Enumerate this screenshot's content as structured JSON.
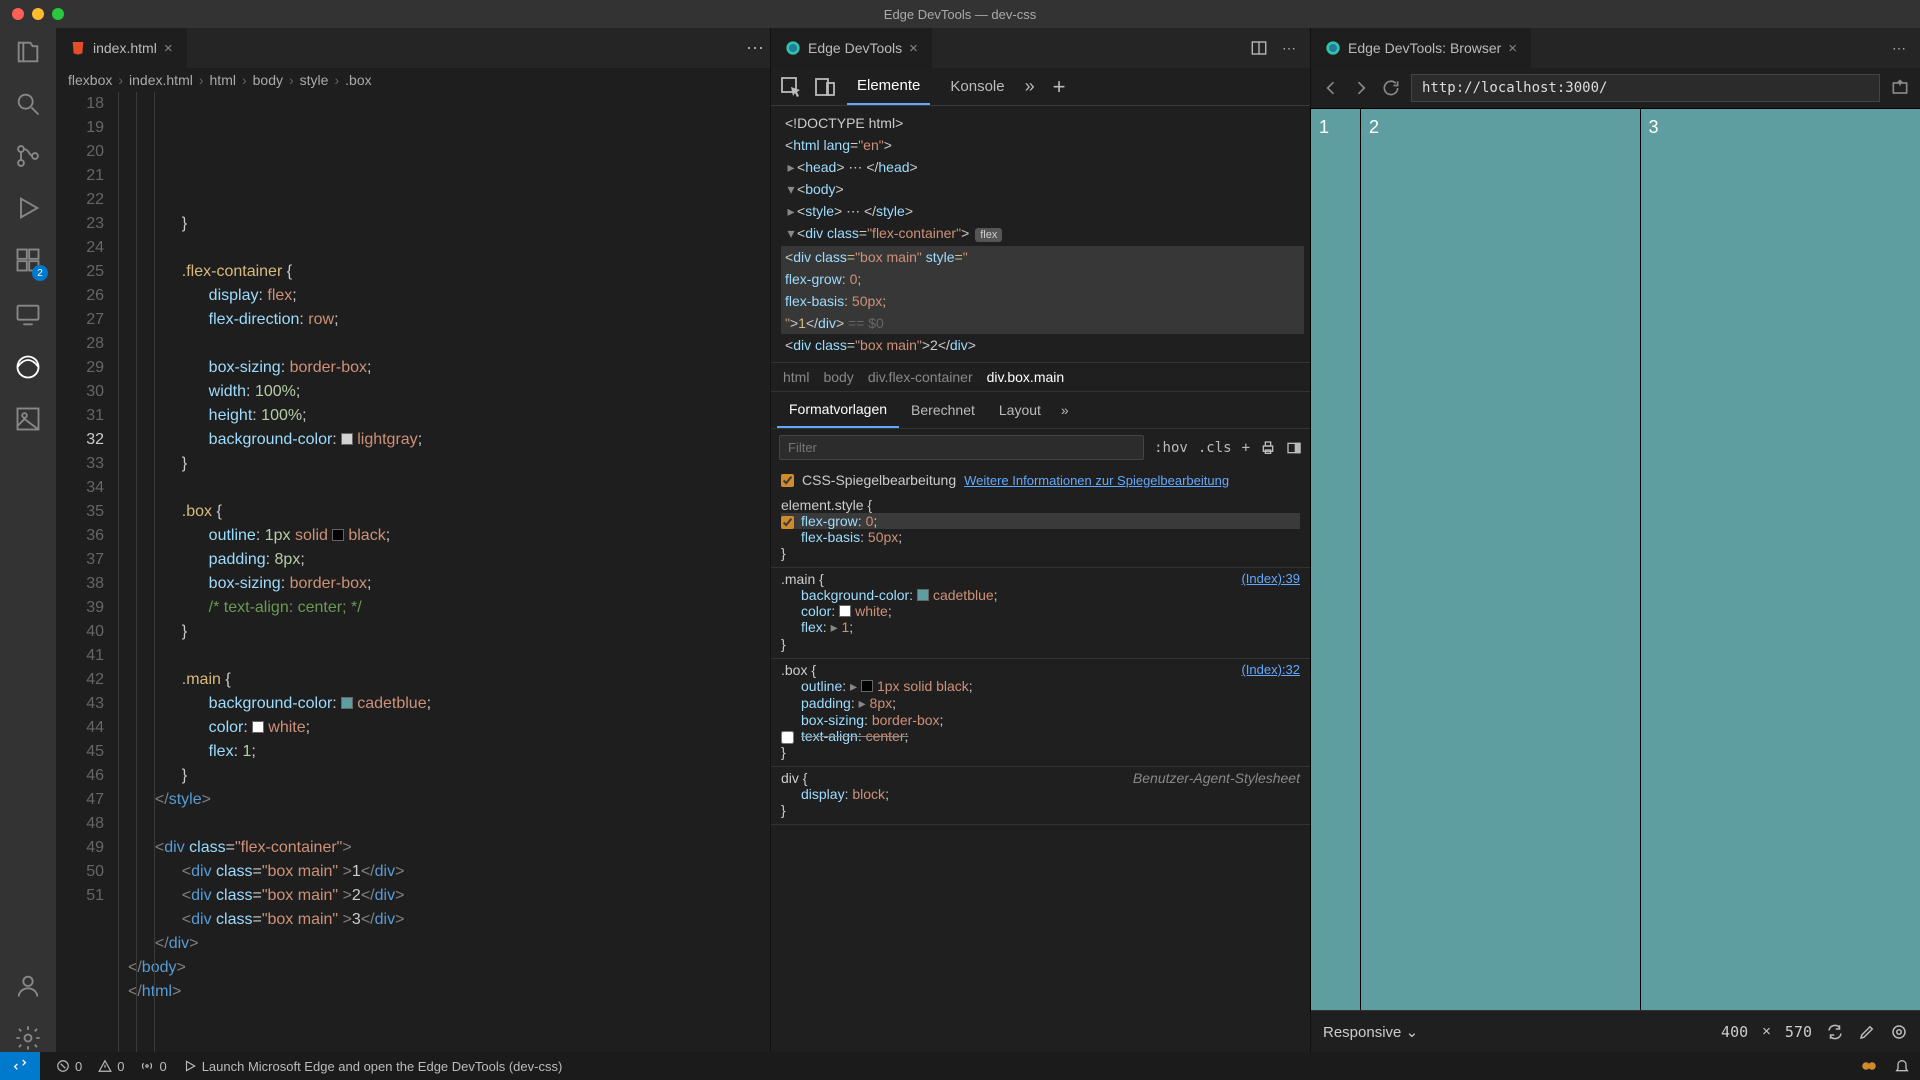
{
  "window": {
    "title": "Edge DevTools — dev-css"
  },
  "activity": {
    "badge": "2"
  },
  "editorTabs": {
    "main": {
      "label": "index.html"
    },
    "devtools": {
      "label": "Edge DevTools"
    },
    "browser": {
      "label": "Edge DevTools: Browser"
    }
  },
  "breadcrumbs": [
    "flexbox",
    "index.html",
    "html",
    "body",
    "style",
    ".box"
  ],
  "codeStartLine": 18,
  "code": [
    {
      "i": 2,
      "html": "<span class='punc'>}</span>"
    },
    {
      "i": 0,
      "html": ""
    },
    {
      "i": 2,
      "html": "<span class='sel'>.flex-container</span> <span class='punc'>{</span>"
    },
    {
      "i": 3,
      "html": "<span class='prop'>display</span><span class='punc'>:</span> <span class='val'>flex</span><span class='punc'>;</span>"
    },
    {
      "i": 3,
      "html": "<span class='prop'>flex-direction</span><span class='punc'>:</span> <span class='val'>row</span><span class='punc'>;</span>"
    },
    {
      "i": 0,
      "html": ""
    },
    {
      "i": 3,
      "html": "<span class='prop'>box-sizing</span><span class='punc'>:</span> <span class='val'>border-box</span><span class='punc'>;</span>"
    },
    {
      "i": 3,
      "html": "<span class='prop'>width</span><span class='punc'>:</span> <span class='num'>100%</span><span class='punc'>;</span>"
    },
    {
      "i": 3,
      "html": "<span class='prop'>height</span><span class='punc'>:</span> <span class='num'>100%</span><span class='punc'>;</span>"
    },
    {
      "i": 3,
      "html": "<span class='prop'>background-color</span><span class='punc'>:</span> <span class='swatch lg'></span><span class='val'>lightgray</span><span class='punc'>;</span>"
    },
    {
      "i": 2,
      "html": "<span class='punc'>}</span>"
    },
    {
      "i": 0,
      "html": ""
    },
    {
      "i": 2,
      "html": "<span class='sel'>.box</span> <span class='punc'>{</span>"
    },
    {
      "i": 3,
      "html": "<span class='prop'>outline</span><span class='punc'>:</span> <span class='num'>1px</span> <span class='val'>solid</span> <span class='swatch bk'></span><span class='val'>black</span><span class='punc'>;</span>"
    },
    {
      "i": 3,
      "html": "<span class='prop'>padding</span><span class='punc'>:</span> <span class='num'>8px</span><span class='punc'>;</span>",
      "current": true
    },
    {
      "i": 3,
      "html": "<span class='prop'>box-sizing</span><span class='punc'>:</span> <span class='val'>border-box</span><span class='punc'>;</span>"
    },
    {
      "i": 3,
      "html": "<span class='comm'>/* text-align: center; */</span>"
    },
    {
      "i": 2,
      "html": "<span class='punc'>}</span>"
    },
    {
      "i": 0,
      "html": ""
    },
    {
      "i": 2,
      "html": "<span class='sel'>.main</span> <span class='punc'>{</span>"
    },
    {
      "i": 3,
      "html": "<span class='prop'>background-color</span><span class='punc'>:</span> <span class='swatch cb'></span><span class='val'>cadetblue</span><span class='punc'>;</span>"
    },
    {
      "i": 3,
      "html": "<span class='prop'>color</span><span class='punc'>:</span> <span class='swatch wh'></span><span class='val'>white</span><span class='punc'>;</span>"
    },
    {
      "i": 3,
      "html": "<span class='prop'>flex</span><span class='punc'>:</span> <span class='num'>1</span><span class='punc'>;</span>"
    },
    {
      "i": 2,
      "html": "<span class='punc'>}</span>"
    },
    {
      "i": 1,
      "html": "<span class='tagbr'>&lt;/</span><span class='tag'>style</span><span class='tagbr'>&gt;</span>"
    },
    {
      "i": 0,
      "html": ""
    },
    {
      "i": 1,
      "html": "<span class='tagbr'>&lt;</span><span class='tag'>div</span> <span class='attr'>class</span>=<span class='str'>\"flex-container\"</span><span class='tagbr'>&gt;</span>"
    },
    {
      "i": 2,
      "html": "<span class='tagbr'>&lt;</span><span class='tag'>div</span> <span class='attr'>class</span>=<span class='str'>\"box main\"</span> <span class='tagbr'>&gt;</span>1<span class='tagbr'>&lt;/</span><span class='tag'>div</span><span class='tagbr'>&gt;</span>"
    },
    {
      "i": 2,
      "html": "<span class='tagbr'>&lt;</span><span class='tag'>div</span> <span class='attr'>class</span>=<span class='str'>\"box main\"</span> <span class='tagbr'>&gt;</span>2<span class='tagbr'>&lt;/</span><span class='tag'>div</span><span class='tagbr'>&gt;</span>"
    },
    {
      "i": 2,
      "html": "<span class='tagbr'>&lt;</span><span class='tag'>div</span> <span class='attr'>class</span>=<span class='str'>\"box main\"</span> <span class='tagbr'>&gt;</span>3<span class='tagbr'>&lt;/</span><span class='tag'>div</span><span class='tagbr'>&gt;</span>"
    },
    {
      "i": 1,
      "html": "<span class='tagbr'>&lt;/</span><span class='tag'>div</span><span class='tagbr'>&gt;</span>"
    },
    {
      "i": 0,
      "html": "<span class='tagbr'>&lt;/</span><span class='tag'>body</span><span class='tagbr'>&gt;</span>"
    },
    {
      "i": 0,
      "html": "<span class='tagbr'>&lt;/</span><span class='tag'>html</span><span class='tagbr'>&gt;</span>"
    },
    {
      "i": 0,
      "html": ""
    }
  ],
  "devtools": {
    "tabs": {
      "elements": "Elemente",
      "console": "Konsole"
    },
    "domLines": [
      "<span class='dompunc'>&lt;!DOCTYPE html&gt;</span>",
      "<span class='dompunc'>&lt;</span><span class='domtag'>html</span> <span class='domattr'>lang</span>=<span class='domstr'>\"en\"</span><span class='dompunc'>&gt;</span>",
      "<span class='tri'>▸</span><span class='dompunc'>&lt;</span><span class='domtag'>head</span><span class='dompunc'>&gt;</span> <span class='dompunc'>⋯</span> <span class='dompunc'>&lt;/</span><span class='domtag'>head</span><span class='dompunc'>&gt;</span>",
      "<span class='tri'>▾</span><span class='dompunc'>&lt;</span><span class='domtag'>body</span><span class='dompunc'>&gt;</span>",
      "  <span class='tri'>▸</span><span class='dompunc'>&lt;</span><span class='domtag'>style</span><span class='dompunc'>&gt;</span> <span class='dompunc'>⋯</span> <span class='dompunc'>&lt;/</span><span class='domtag'>style</span><span class='dompunc'>&gt;</span>",
      "  <span class='tri'>▾</span><span class='dompunc'>&lt;</span><span class='domtag'>div</span> <span class='domattr'>class</span>=<span class='domstr'>\"flex-container\"</span><span class='dompunc'>&gt;</span><span class='dombadge'>flex</span>",
      "    <span class='dompunc'>&lt;</span><span class='domtag'>div</span> <span class='domattr'>class</span>=<span class='domstr'>\"box main\"</span> <span class='domattr'>style</span>=<span class='domstr'>\"</span>",
      "        <span class='domattr'>flex-grow</span>: <span class='domstr'>0</span>;",
      "        <span class='domattr'>flex-basis</span>: <span class='domstr'>50px</span>;",
      "    <span class='domstr'>\"</span><span class='dompunc'>&gt;</span>1<span class='dompunc'>&lt;/</span><span class='domtag'>div</span><span class='dompunc'>&gt;</span> <span style='color:#666'>== $0</span>",
      "    <span class='dompunc'>&lt;</span><span class='domtag'>div</span> <span class='domattr'>class</span>=<span class='domstr'>\"box main\"</span><span class='dompunc'>&gt;</span>2<span class='dompunc'>&lt;/</span><span class='domtag'>div</span><span class='dompunc'>&gt;</span>"
    ],
    "domSelectedIndex": 6,
    "bc": [
      "html",
      "body",
      "div.flex-container",
      "div.box.main"
    ],
    "stylesTabs": {
      "styles": "Formatvorlagen",
      "computed": "Berechnet",
      "layout": "Layout"
    },
    "filterPH": "Filter",
    "hov": ":hov",
    "cls": ".cls",
    "mirror": {
      "label": "CSS-Spiegelbearbeitung",
      "link": "Weitere Informationen zur Spiegelbearbeitung"
    },
    "rules": [
      {
        "selector": "element.style {",
        "decls": [
          {
            "p": "flex-grow",
            "v": "0",
            "checked": true,
            "hl": true
          },
          {
            "p": "flex-basis",
            "v": "50px",
            "boxed": true
          }
        ]
      },
      {
        "selector": ".main {",
        "link": "(Index):39",
        "decls": [
          {
            "p": "background-color",
            "v": "cadetblue",
            "sw": "cadetblue"
          },
          {
            "p": "color",
            "v": "white",
            "sw": "white"
          },
          {
            "p": "flex",
            "v": "1",
            "expand": true
          }
        ]
      },
      {
        "selector": ".box {",
        "link": "(Index):32",
        "decls": [
          {
            "p": "outline",
            "v": "1px solid  black",
            "expand": true,
            "sw": "black"
          },
          {
            "p": "padding",
            "v": "8px",
            "expand": true
          },
          {
            "p": "box-sizing",
            "v": "border-box"
          },
          {
            "p": "text-align",
            "v": "center",
            "strike": true,
            "checked": false
          }
        ]
      },
      {
        "selector": "div {",
        "ua": "Benutzer-Agent-Stylesheet",
        "decls": [
          {
            "p": "display",
            "v": "block"
          }
        ]
      }
    ]
  },
  "browser": {
    "url": "http://localhost:3000/",
    "cells": [
      "1",
      "2",
      "3"
    ],
    "responsive": "Responsive",
    "dimW": "400",
    "dimH": "570"
  },
  "status": {
    "errors": "0",
    "warnings": "0",
    "port": "0",
    "launch": "Launch Microsoft Edge and open the Edge DevTools (dev-css)"
  }
}
